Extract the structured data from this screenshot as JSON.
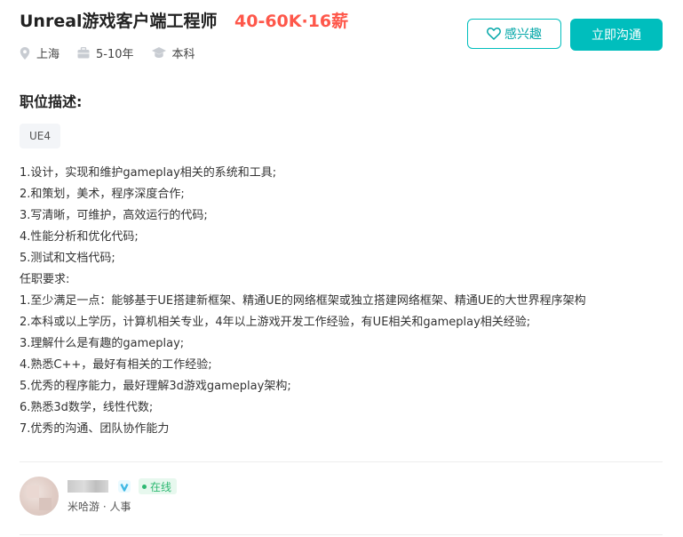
{
  "header": {
    "job_title": "Unreal游戏客户端工程师",
    "salary": "40-60K·16薪"
  },
  "meta": {
    "location": "上海",
    "experience": "5-10年",
    "education": "本科"
  },
  "actions": {
    "interest_label": "感兴趣",
    "chat_label": "立即沟通"
  },
  "description": {
    "title": "职位描述:",
    "tag": "UE4",
    "lines": [
      "1.设计，实现和维护gameplay相关的系统和工具;",
      "2.和策划，美术，程序深度合作;",
      "3.写清晰，可维护，高效运行的代码;",
      "4.性能分析和优化代码;",
      "5.测试和文档代码;",
      "任职要求:",
      "1.至少满足一点：能够基于UE搭建新框架、精通UE的网络框架或独立搭建网络框架、精通UE的大世界程序架构",
      "2.本科或以上学历，计算机相关专业，4年以上游戏开发工作经验，有UE相关和gameplay相关经验;",
      "3.理解什么是有趣的gameplay;",
      "4.熟悉C++，最好有相关的工作经验;",
      "5.优秀的程序能力，最好理解3d游戏gameplay架构;",
      "6.熟悉3d数学，线性代数;",
      "7.优秀的沟通、团队协作能力"
    ]
  },
  "recruiter": {
    "status": "在线",
    "company_role": "米哈游 · 人事"
  },
  "colors": {
    "accent": "#00bebd",
    "salary": "#fe574a",
    "online": "#2eb872"
  }
}
